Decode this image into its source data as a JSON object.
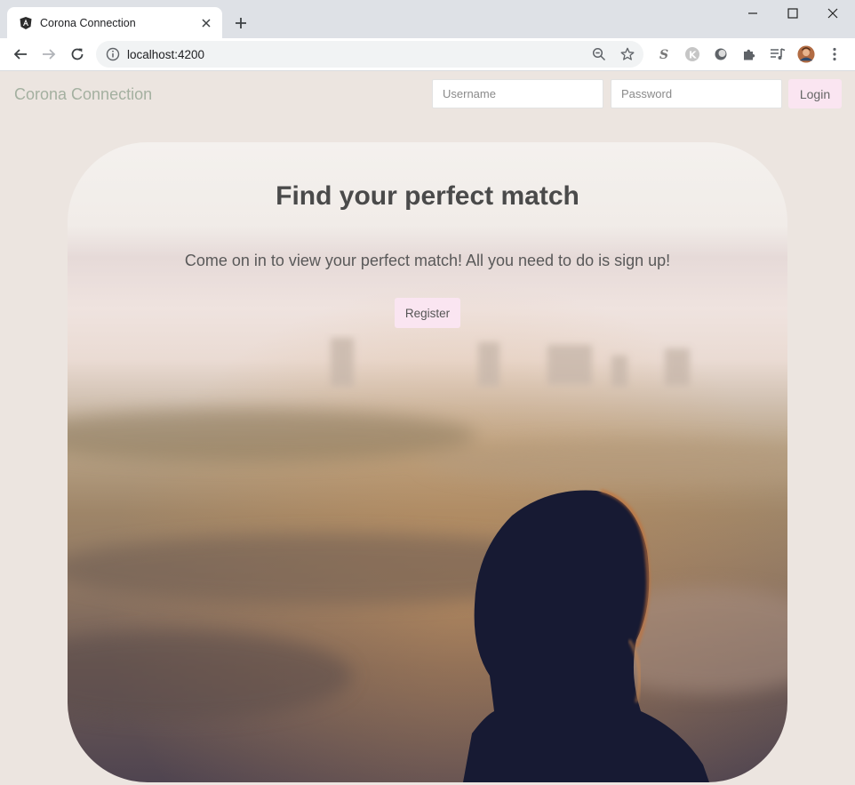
{
  "browser": {
    "tab_title": "Corona Connection",
    "url": "localhost:4200"
  },
  "page": {
    "brand": "Corona Connection",
    "login": {
      "username_placeholder": "Username",
      "password_placeholder": "Password",
      "button_label": "Login"
    },
    "hero": {
      "title": "Find your perfect match",
      "subtitle": "Come on in to view your perfect match! All you need to do is sign up!",
      "button_label": "Register"
    }
  },
  "colors": {
    "page_bg": "#ece5e0",
    "brand": "#a4b0a0",
    "button_bg": "#fae5f1"
  },
  "icons": [
    "angular-icon",
    "close-icon",
    "plus-icon",
    "minimize-icon",
    "maximize-icon",
    "back-icon",
    "forward-icon",
    "reload-icon",
    "info-icon",
    "zoom-icon",
    "star-icon",
    "s-extension-icon",
    "k-extension-icon",
    "circle-extension-icon",
    "puzzle-icon",
    "media-icon",
    "avatar",
    "kebab-menu-icon"
  ]
}
